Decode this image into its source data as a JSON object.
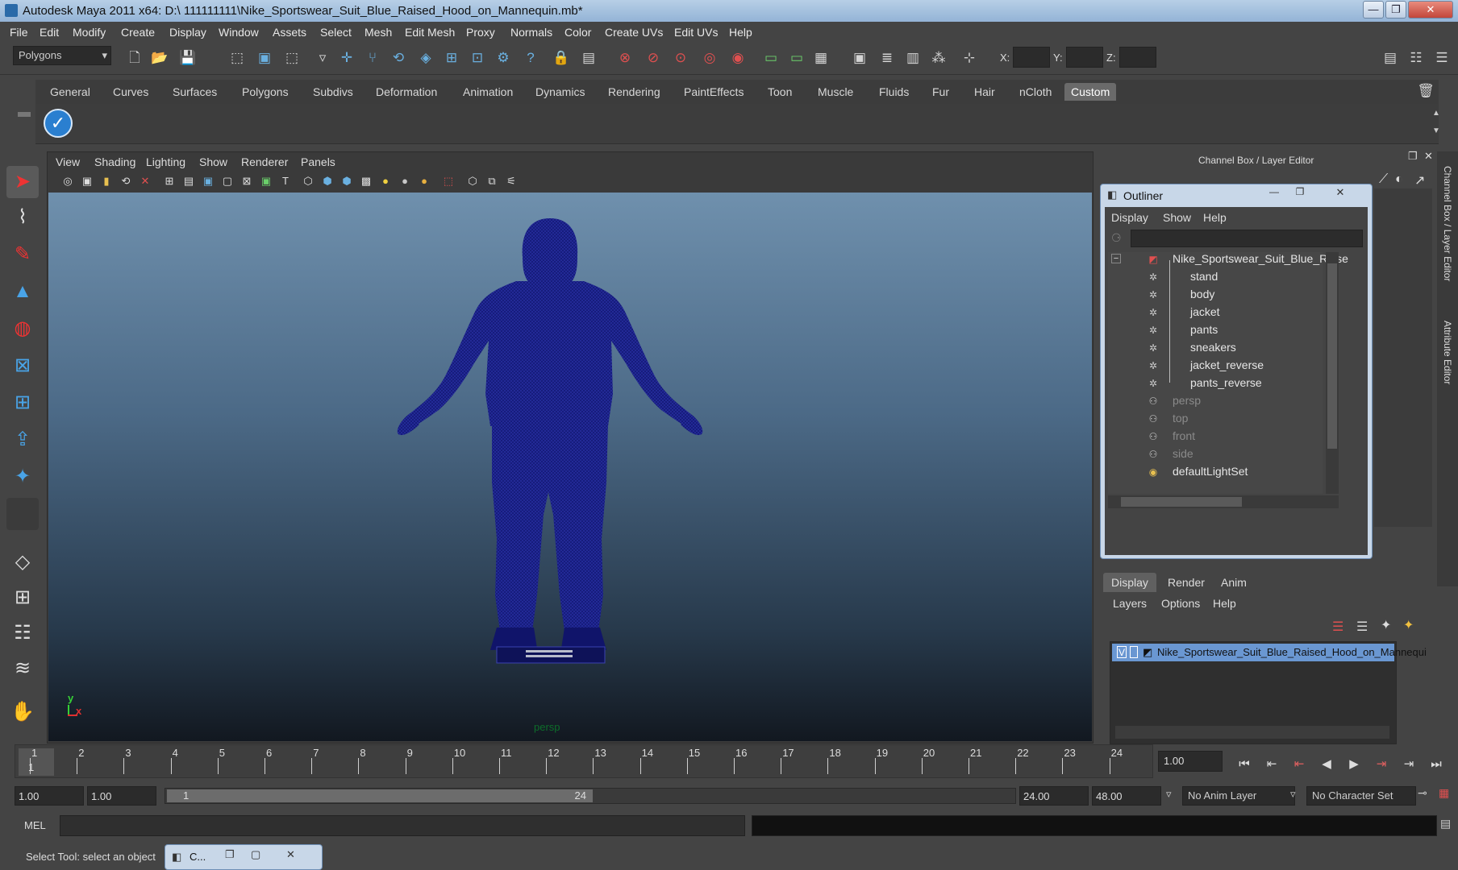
{
  "window": {
    "title": "Autodesk Maya 2011 x64: D:\\ 111111111\\Nike_Sportswear_Suit_Blue_Raised_Hood_on_Mannequin.mb*",
    "minimize": "—",
    "maximize": "❐",
    "close": "✕"
  },
  "menubar": [
    "File",
    "Edit",
    "Modify",
    "Create",
    "Display",
    "Window",
    "Assets",
    "Select",
    "Mesh",
    "Edit Mesh",
    "Proxy",
    "Normals",
    "Color",
    "Create UVs",
    "Edit UVs",
    "Help"
  ],
  "statusline": {
    "mode": "Polygons",
    "x_label": "X:",
    "y_label": "Y:",
    "z_label": "Z:"
  },
  "shelf_tabs": [
    "General",
    "Curves",
    "Surfaces",
    "Polygons",
    "Subdivs",
    "Deformation",
    "Animation",
    "Dynamics",
    "Rendering",
    "PaintEffects",
    "Toon",
    "Muscle",
    "Fluids",
    "Fur",
    "Hair",
    "nCloth",
    "Custom"
  ],
  "active_shelf_tab": "Custom",
  "viewport": {
    "menus": [
      "View",
      "Shading",
      "Lighting",
      "Show",
      "Renderer",
      "Panels"
    ],
    "camera_label": "persp",
    "axis_y": "y",
    "axis_x": "x"
  },
  "channel_box": {
    "title": "Channel Box / Layer Editor",
    "vtab1": "Channel Box / Layer Editor",
    "vtab2": "Attribute Editor"
  },
  "outliner": {
    "title": "Outliner",
    "menus": [
      "Display",
      "Show",
      "Help"
    ],
    "root": "Nike_Sportswear_Suit_Blue_Raise",
    "children": [
      "stand",
      "body",
      "jacket",
      "pants",
      "sneakers",
      "jacket_reverse",
      "pants_reverse"
    ],
    "cameras": [
      "persp",
      "top",
      "front",
      "side"
    ],
    "sets": [
      "defaultLightSet"
    ]
  },
  "layer_editor": {
    "tabs": [
      "Display",
      "Render",
      "Anim"
    ],
    "menus": [
      "Layers",
      "Options",
      "Help"
    ],
    "layer_visibility": "V",
    "layer_name": "Nike_Sportswear_Suit_Blue_Raised_Hood_on_Mannequi"
  },
  "timeline": {
    "frames": [
      "1",
      "2",
      "3",
      "4",
      "5",
      "6",
      "7",
      "8",
      "9",
      "10",
      "11",
      "12",
      "13",
      "14",
      "15",
      "16",
      "17",
      "18",
      "19",
      "20",
      "21",
      "22",
      "23",
      "24"
    ],
    "current_frame_marker": "1",
    "current_time": "1.00"
  },
  "range": {
    "start_time": "1.00",
    "playback_start": "1.00",
    "range_start_label": "1",
    "range_end_label": "24",
    "playback_end": "24.00",
    "end_time": "48.00",
    "anim_layer": "No Anim Layer",
    "character_set": "No Character Set"
  },
  "mel": {
    "label": "MEL"
  },
  "helpline": {
    "text": "Select Tool: select an object",
    "mini_window": "C..."
  }
}
